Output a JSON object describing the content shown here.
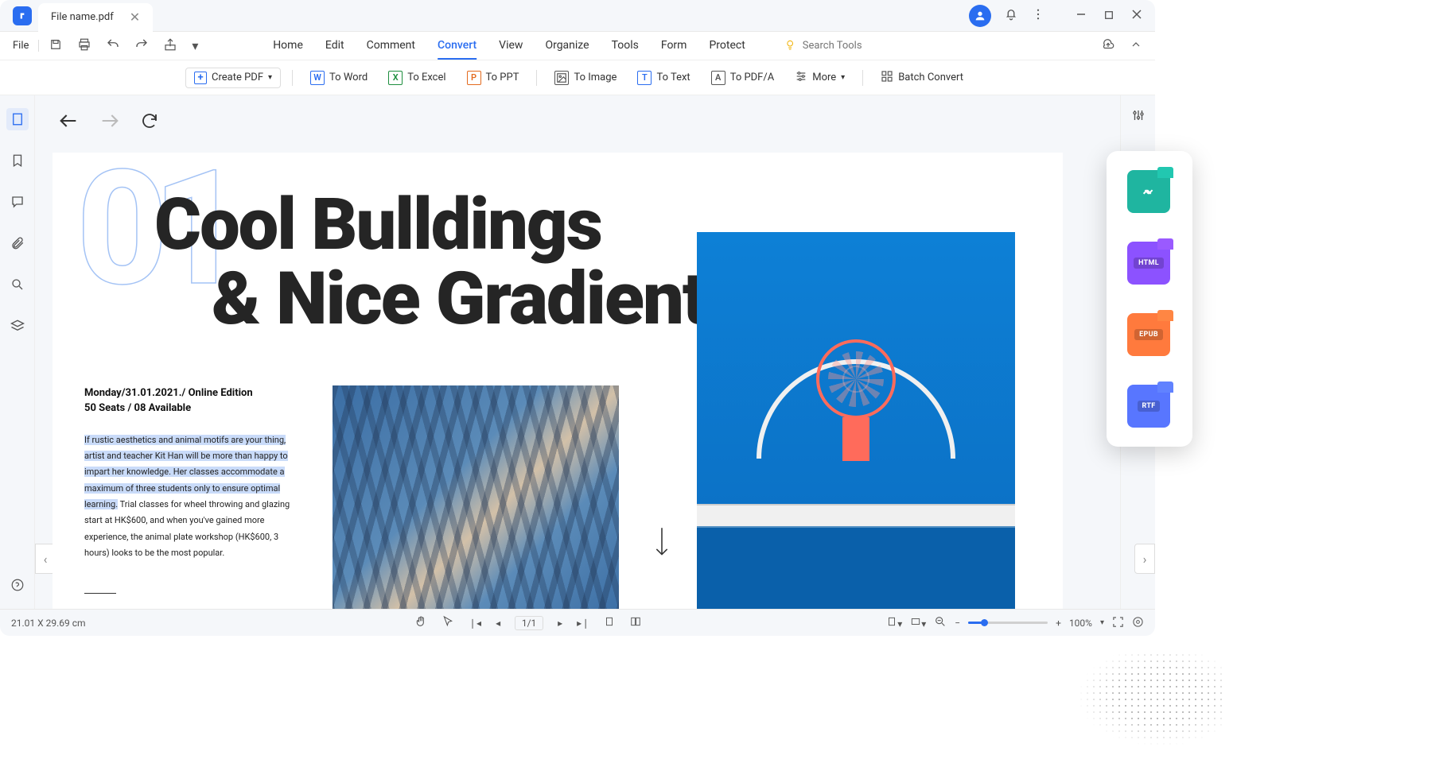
{
  "titlebar": {
    "tab_title": "File name.pdf"
  },
  "menubar": {
    "file": "File",
    "tabs": [
      "Home",
      "Edit",
      "Comment",
      "Convert",
      "View",
      "Organize",
      "Tools",
      "Form",
      "Protect"
    ],
    "active_tab": "Convert",
    "search_placeholder": "Search Tools"
  },
  "toolbar": {
    "create": "Create PDF",
    "to_word": "To Word",
    "to_excel": "To Excel",
    "to_ppt": "To PPT",
    "to_image": "To Image",
    "to_text": "To Text",
    "to_pdfa": "To PDF/A",
    "more": "More",
    "batch": "Batch Convert"
  },
  "document": {
    "number": "01",
    "title_line1": "Cool Bulldings",
    "title_line2": "& Nice Gradients",
    "meta_line1": "Monday/31.01.2021./ Online Edition",
    "meta_line2": "50 Seats / 08 Available",
    "body_hl": "If rustic aesthetics and animal motifs are your thing, artist and teacher Kit Han will be more than happy to impart her knowledge. Her classes accommodate a maximum of three students only to ensure optimal learning.",
    "body_rest": " Trial classes for wheel throwing and glazing start at HK$600, and when you've gained more experience, the animal plate workshop (HK$600, 3 hours) looks to be the most popular."
  },
  "statusbar": {
    "dimensions": "21.01 X 29.69 cm",
    "page": "1/1",
    "zoom": "100%"
  },
  "float_panel": {
    "html": "HTML",
    "epub": "EPUB",
    "rtf": "RTF"
  }
}
